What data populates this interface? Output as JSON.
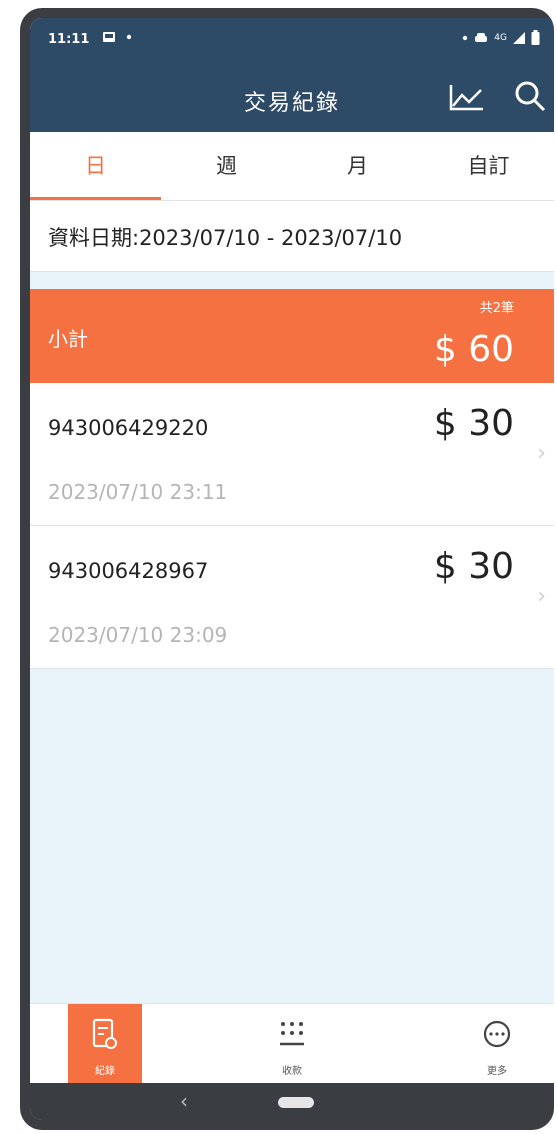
{
  "status_bar": {
    "time": "11:11",
    "network": "4G"
  },
  "app_bar": {
    "title": "交易紀錄"
  },
  "tabs": [
    {
      "label": "日",
      "active": true
    },
    {
      "label": "週",
      "active": false
    },
    {
      "label": "月",
      "active": false
    },
    {
      "label": "自訂",
      "active": false
    }
  ],
  "date_range": {
    "text": "資料日期:2023/07/10 - 2023/07/10"
  },
  "subtotal": {
    "label": "小計",
    "count": "共2筆",
    "amount": "$ 60"
  },
  "records": [
    {
      "id": "943006429220",
      "amount": "$ 30",
      "time": "2023/07/10 23:11"
    },
    {
      "id": "943006428967",
      "amount": "$ 30",
      "time": "2023/07/10 23:09"
    }
  ],
  "bottom_nav": [
    {
      "label": "紀錄",
      "icon": "receipt-icon",
      "active": true
    },
    {
      "label": "收款",
      "icon": "keypad-icon",
      "active": false
    },
    {
      "label": "更多",
      "icon": "more-icon",
      "active": false
    }
  ],
  "colors": {
    "primary": "#2d4a66",
    "accent": "#f57142",
    "background": "#e8f4fa"
  }
}
